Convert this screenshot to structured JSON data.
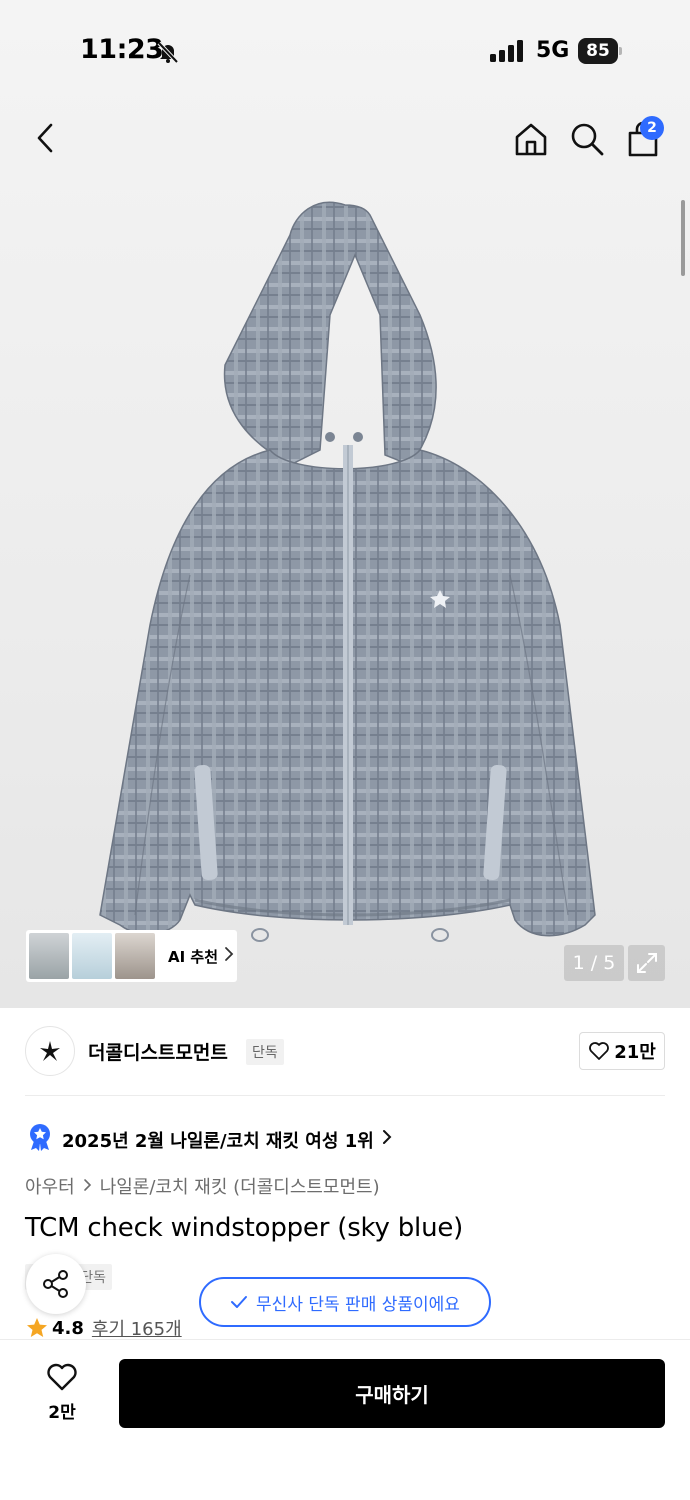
{
  "status_bar": {
    "time": "11:23",
    "network": "5G",
    "battery": "85"
  },
  "header": {
    "cart_count": "2"
  },
  "gallery": {
    "counter": "1 / 5",
    "ai_label": "AI 추천"
  },
  "brand": {
    "name": "더콜디스트모먼트",
    "tag": "단독",
    "likes": "21만"
  },
  "ranking": {
    "text": "2025년 2월 나일론/코치 재킷 여성 1위"
  },
  "breadcrumb": {
    "items": [
      "아우터",
      "나일론/코치 재킷 (더콜디스트모먼트)"
    ]
  },
  "product": {
    "title": "TCM check windstopper (sky blue)",
    "tag": "단독",
    "exclusive_notice": "무신사 단독 판매 상품이에요",
    "rating": "4.8",
    "reviews": "후기 165개"
  },
  "bottom_bar": {
    "wish_count": "2만",
    "buy_label": "구매하기"
  },
  "colors": {
    "accent": "#2f6bff",
    "rating_star": "#f5a623",
    "buy_button": "#000000"
  }
}
